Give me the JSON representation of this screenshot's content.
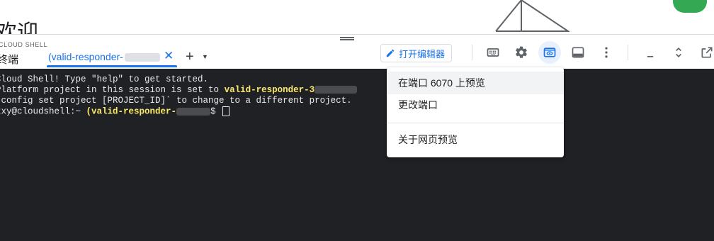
{
  "page": {
    "heading": "欢迎"
  },
  "panel": {
    "title": "CLOUD SHELL",
    "subtitle": "终端",
    "tab": {
      "label": "(valid-responder-"
    },
    "editor_button": "打开编辑器",
    "icons": [
      "keyboard-icon",
      "gear-icon",
      "web-preview-icon",
      "panel-icon",
      "more-vert-icon",
      "minimize-icon",
      "expand-icon",
      "open-new-window-icon"
    ]
  },
  "terminal": {
    "line1": "Cloud Shell! Type \"help\" to get started.",
    "line2_prefix": "Platform project in this session is set to ",
    "line2_project": "valid-responder-3",
    "line3": " config set project [PROJECT_ID]` to change to a different project.",
    "prompt_user": "zxy@cloudshell:~ ",
    "prompt_project": "(valid-responder-",
    "prompt_suffix": "$ "
  },
  "menu": {
    "items": [
      "在端口 6070 上预览",
      "更改端口",
      "关于网页预览"
    ]
  },
  "colors": {
    "accent": "#1a73e8",
    "terminal_bg": "#202124",
    "highlight": "#fce96a"
  }
}
